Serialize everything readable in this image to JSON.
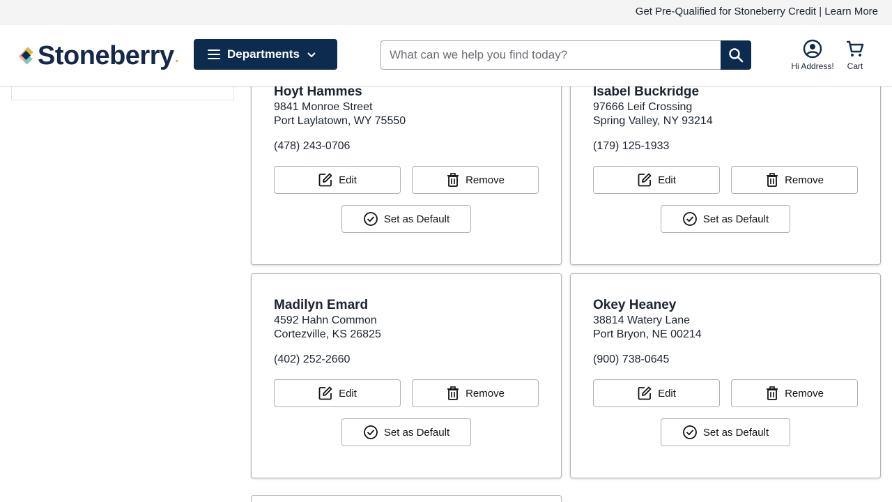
{
  "promo": {
    "text": "Get Pre-Qualified for Stoneberry Credit | Learn More"
  },
  "header": {
    "logo_text": "Stoneberry",
    "departments_label": "Departments",
    "search_placeholder": "What can we help you find today?",
    "account_label": "Hi Address!",
    "cart_label": "Cart"
  },
  "colors": {
    "brand_navy": "#0d2b4e",
    "logo_gold": "#e1b43a",
    "logo_teal": "#7bc8c0",
    "logo_pink": "#f1a7a7"
  },
  "buttons": {
    "edit": "Edit",
    "remove": "Remove",
    "set_default": "Set as Default"
  },
  "addresses": [
    {
      "name": "Hoyt Hammes",
      "street": "9841 Monroe Street",
      "city": "Port Laylatown, WY 75550",
      "phone": "(478) 243-0706"
    },
    {
      "name": "Isabel Buckridge",
      "street": "97666 Leif Crossing",
      "city": "Spring Valley, NY 93214",
      "phone": "(179) 125-1933"
    },
    {
      "name": "Madilyn Emard",
      "street": "4592 Hahn Common",
      "city": "Cortezville, KS 26825",
      "phone": "(402) 252-2660"
    },
    {
      "name": "Okey Heaney",
      "street": "38814 Watery Lane",
      "city": "Port Bryon, NE 00214",
      "phone": "(900) 738-0645"
    }
  ]
}
